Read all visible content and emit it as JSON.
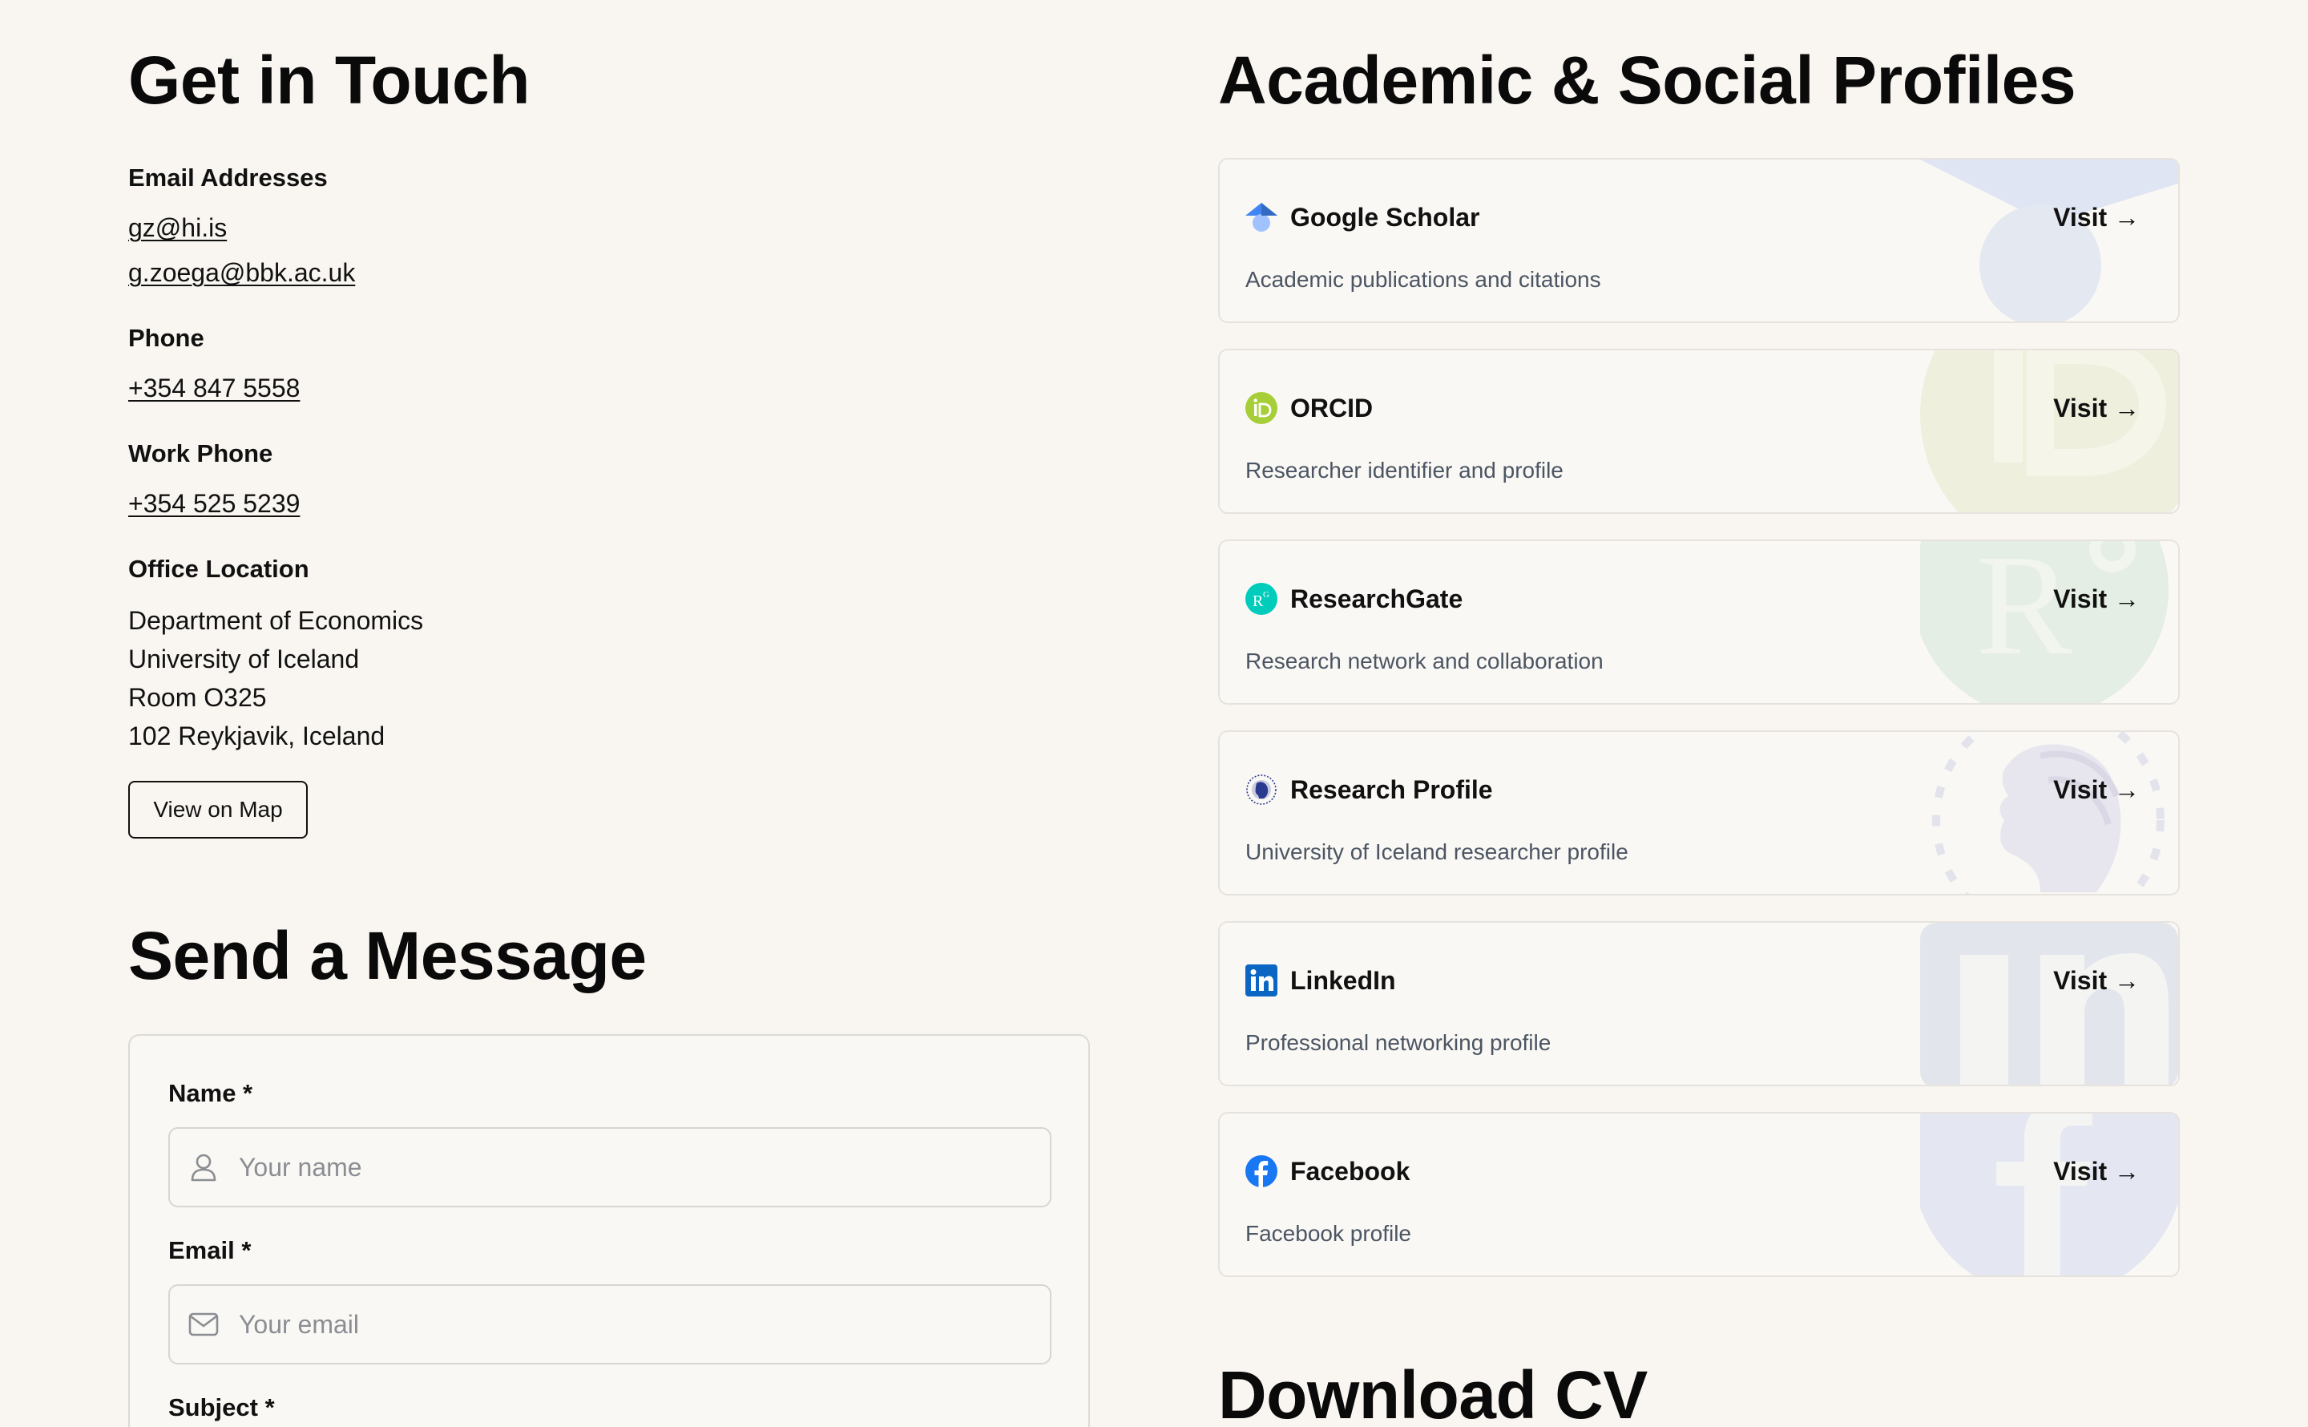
{
  "contact": {
    "title": "Get in Touch",
    "email_label": "Email Addresses",
    "emails": [
      "gz@hi.is",
      "g.zoega@bbk.ac.uk"
    ],
    "phone_label": "Phone",
    "phone": "+354 847 5558",
    "work_phone_label": "Work Phone",
    "work_phone": "+354 525 5239",
    "office_label": "Office Location",
    "address_lines": [
      "Department of Economics",
      "University of Iceland",
      "Room O325",
      "102 Reykjavik, Iceland"
    ],
    "map_button": "View on Map"
  },
  "message": {
    "title": "Send a Message",
    "fields": [
      {
        "label": "Name *",
        "placeholder": "Your name",
        "icon": "user-icon"
      },
      {
        "label": "Email *",
        "placeholder": "Your email",
        "icon": "mail-icon"
      },
      {
        "label": "Subject *",
        "placeholder": "",
        "icon": ""
      }
    ]
  },
  "profiles": {
    "title": "Academic & Social Profiles",
    "visit_label": "Visit →",
    "items": [
      {
        "name": "Google Scholar",
        "description": "Academic publications and citations",
        "icon": "google-scholar-icon",
        "color": "#4285f4"
      },
      {
        "name": "ORCID",
        "description": "Researcher identifier and profile",
        "icon": "orcid-icon",
        "color": "#a6ce39"
      },
      {
        "name": "ResearchGate",
        "description": "Research network and collaboration",
        "icon": "researchgate-icon",
        "color": "#00ccbb"
      },
      {
        "name": "Research Profile",
        "description": "University of Iceland researcher profile",
        "icon": "university-seal-icon",
        "color": "#2a3b8f"
      },
      {
        "name": "LinkedIn",
        "description": "Professional networking profile",
        "icon": "linkedin-icon",
        "color": "#0a66c2"
      },
      {
        "name": "Facebook",
        "description": "Facebook profile",
        "icon": "facebook-icon",
        "color": "#1877f2"
      }
    ]
  },
  "cv": {
    "title": "Download CV"
  }
}
